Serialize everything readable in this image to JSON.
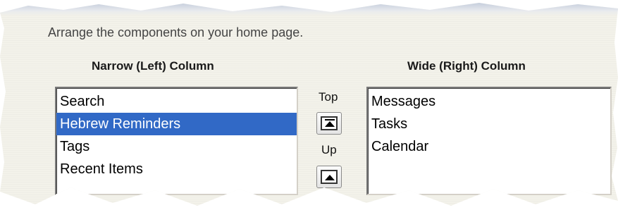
{
  "instruction": "Arrange the components on your home page.",
  "left_column": {
    "heading": "Narrow (Left) Column",
    "items": [
      {
        "label": "Search",
        "selected": false
      },
      {
        "label": "Hebrew Reminders",
        "selected": true
      },
      {
        "label": "Tags",
        "selected": false
      },
      {
        "label": "Recent Items",
        "selected": false
      }
    ]
  },
  "right_column": {
    "heading": "Wide (Right) Column",
    "items": [
      {
        "label": "Messages",
        "selected": false
      },
      {
        "label": "Tasks",
        "selected": false
      },
      {
        "label": "Calendar",
        "selected": false
      }
    ]
  },
  "controls": {
    "top_label": "Top",
    "top_icon": "move-to-top-icon",
    "up_label": "Up",
    "up_icon": "move-up-icon"
  },
  "colors": {
    "selection": "#3169c6",
    "panel": "#f3f2ea"
  }
}
